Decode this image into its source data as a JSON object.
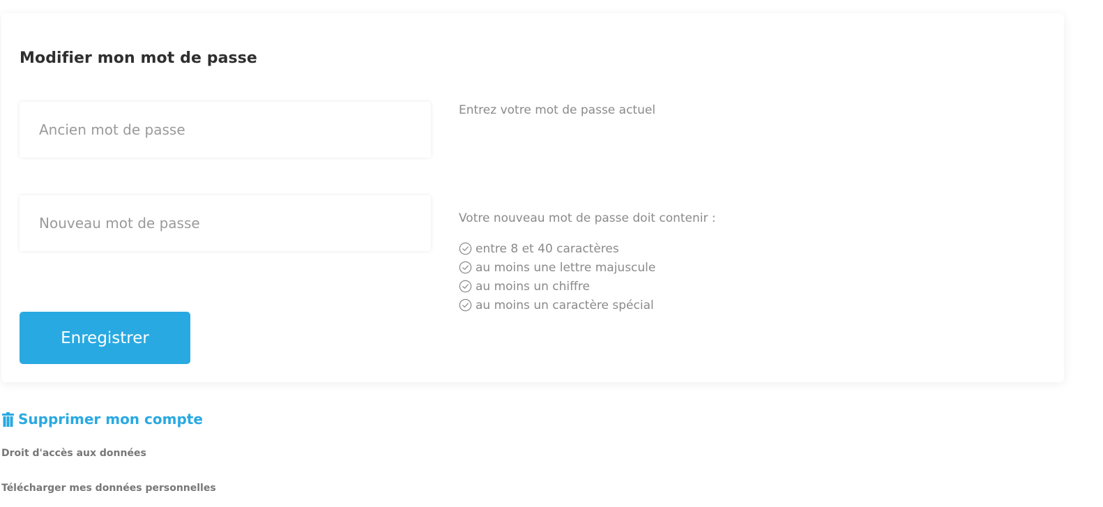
{
  "password_card": {
    "title": "Modifier mon mot de passe",
    "old_password": {
      "placeholder": "Ancien mot de passe",
      "value": "",
      "hint": "Entrez votre mot de passe actuel"
    },
    "new_password": {
      "placeholder": "Nouveau mot de passe",
      "value": "",
      "hint": "Votre nouveau mot de passe doit contenir :",
      "requirements": [
        {
          "label": "entre 8 et 40 caractères",
          "icon": "check-circle-icon"
        },
        {
          "label": "au moins une lettre majuscule",
          "icon": "check-circle-icon"
        },
        {
          "label": "au moins un chiffre",
          "icon": "check-circle-icon"
        },
        {
          "label": "au moins un caractère spécial",
          "icon": "check-circle-icon"
        }
      ]
    },
    "save_label": "Enregistrer"
  },
  "account": {
    "delete_label": "Supprimer mon compte",
    "delete_icon": "trash-icon",
    "data_access_label": "Droit d'accès aux données",
    "download_label": "Télécharger mes données personnelles"
  },
  "colors": {
    "accent": "#29a9e1",
    "muted_text": "#8a8a8a",
    "title_text": "#2f2f2f"
  }
}
